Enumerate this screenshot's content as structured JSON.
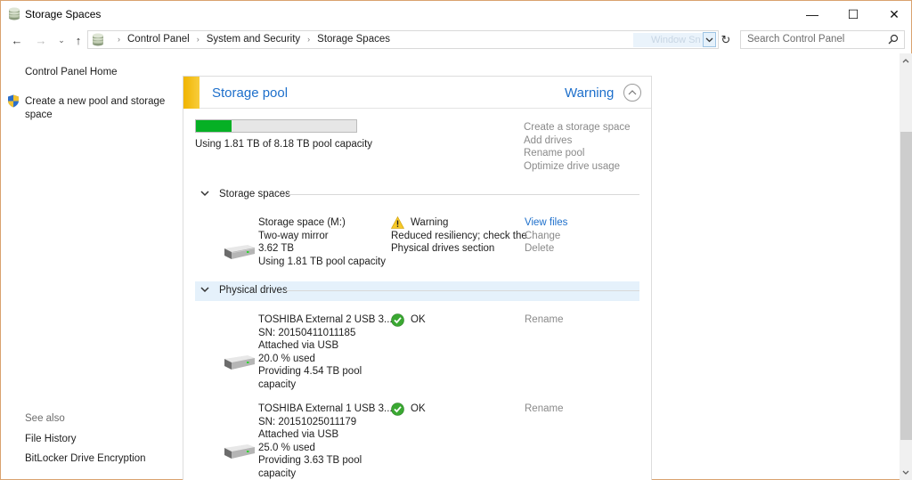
{
  "window": {
    "title": "Storage Spaces",
    "controls": {
      "minimize": "—",
      "maximize": "☐",
      "close": "✕"
    }
  },
  "nav": {
    "back": "←",
    "forward": "→",
    "recent": "⌄",
    "up": "↑",
    "breadcrumb": [
      "Control Panel",
      "System and Security",
      "Storage Spaces"
    ],
    "breadcrumb_separator": "›",
    "ghost_overlay_text": "Window Sn",
    "refresh": "↻",
    "search_placeholder": "Search Control Panel"
  },
  "sidebar": {
    "home_link": "Control Panel Home",
    "create_link": "Create a new pool and storage space",
    "see_also_label": "See also",
    "see_also": [
      "File History",
      "BitLocker Drive Encryption"
    ]
  },
  "pool": {
    "title": "Storage pool",
    "status": "Warning",
    "status_color": "#1d6fcb",
    "accent_color": "#f0b400",
    "capacity_used_fraction": 0.221,
    "usage_text": "Using 1.81 TB of 8.18 TB pool capacity",
    "actions": [
      "Create a storage space",
      "Add drives",
      "Rename pool",
      "Optimize drive usage"
    ],
    "storage_spaces_label": "Storage spaces",
    "storage_spaces": [
      {
        "name": "Storage space (M:)",
        "resiliency": "Two-way mirror",
        "size": "3.62 TB",
        "usage": "Using 1.81 TB pool capacity",
        "status": "Warning",
        "status_detail_1": "Reduced resiliency; check the",
        "status_detail_2": "Physical drives section",
        "actions": {
          "view": "View files",
          "change": "Change",
          "delete": "Delete"
        }
      }
    ],
    "physical_drives_label": "Physical drives",
    "physical_drives": [
      {
        "name": "TOSHIBA External 2 USB 3....",
        "serial": "SN: 20150411011185",
        "connection": "Attached via USB",
        "used": "20.0 % used",
        "providing_1": "Providing 4.54 TB pool",
        "providing_2": "capacity",
        "status": "OK",
        "action": "Rename"
      },
      {
        "name": "TOSHIBA External 1 USB 3....",
        "serial": "SN: 20151025011179",
        "connection": "Attached via USB",
        "used": "25.0 % used",
        "providing_1": "Providing 3.63 TB pool",
        "providing_2": "capacity",
        "status": "OK",
        "action": "Rename"
      }
    ]
  }
}
